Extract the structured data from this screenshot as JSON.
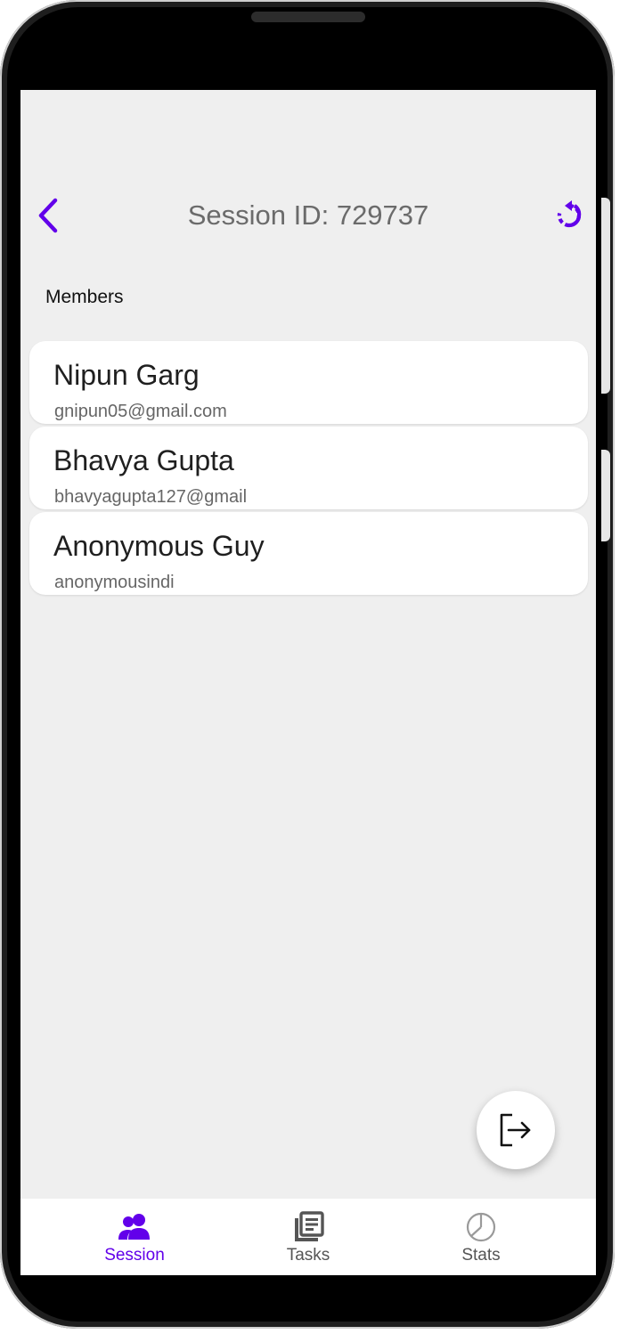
{
  "appbar": {
    "title": "Session ID: 729737",
    "back_icon": "chevron-left-icon",
    "refresh_icon": "refresh-icon"
  },
  "members_section": {
    "label": "Members",
    "items": [
      {
        "name": "Nipun Garg",
        "email": "gnipun05@gmail.com"
      },
      {
        "name": "Bhavya Gupta",
        "email": "bhavyagupta127@gmail"
      },
      {
        "name": "Anonymous Guy",
        "email": "anonymousindi"
      }
    ]
  },
  "fab": {
    "icon": "exit-icon"
  },
  "bottom_nav": {
    "items": [
      {
        "label": "Session",
        "icon": "people-icon",
        "active": true
      },
      {
        "label": "Tasks",
        "icon": "list-icon",
        "active": false
      },
      {
        "label": "Stats",
        "icon": "pie-chart-icon",
        "active": false
      }
    ]
  },
  "colors": {
    "accent": "#6200ea",
    "background": "#efefef",
    "card": "#ffffff"
  }
}
